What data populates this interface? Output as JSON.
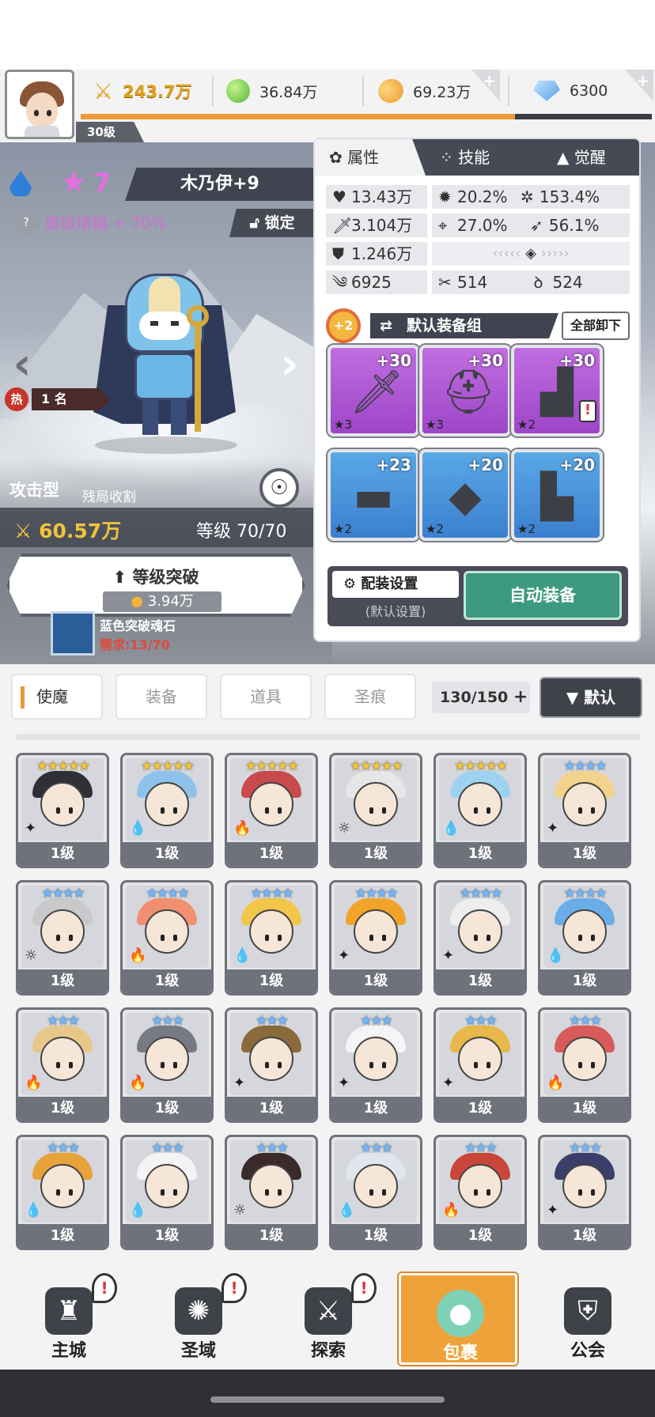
{
  "player": {
    "level": "30级",
    "xp_progress": 0.76
  },
  "currencies": {
    "power": "243.7万",
    "green_orb": "36.84万",
    "gold": "69.23万",
    "diamond": "6300"
  },
  "hero": {
    "element_icon": "water-drop-icon",
    "star_count": "7",
    "name": "木乃伊+9",
    "star_boost": "星级增幅 + 70%",
    "lock_label": "锁定",
    "rank_hot": "热",
    "rank": "1 名",
    "role": "攻击型",
    "role_desc": "残局收割",
    "power": "60.57万",
    "level": "等级 70/70",
    "breakthrough_label": "等级突破",
    "breakthrough_cost": "3.94万",
    "soul_stone_name": "蓝色突破魂石",
    "soul_stone_need": "需求:13/70"
  },
  "panel": {
    "tabs": [
      "属性",
      "技能",
      "觉醒"
    ],
    "stats": {
      "hp": "13.43万",
      "crit_rate": "20.2%",
      "crit_dmg": "153.4%",
      "atk": "3.104万",
      "accuracy": "27.0%",
      "dodge": "56.1%",
      "def": "1.246万",
      "speed": "6925",
      "stat_a": "514",
      "stat_b": "524"
    },
    "gear_bonus": "+2",
    "gear_group": "默认装备组",
    "unequip_all": "全部卸下",
    "slots": [
      {
        "level": "+30",
        "stars": "★3",
        "color": "purple",
        "icon": "sword-icon"
      },
      {
        "level": "+30",
        "stars": "★3",
        "color": "purple",
        "icon": "helmet-icon"
      },
      {
        "level": "+30",
        "stars": "★2",
        "color": "purple",
        "icon": "armor-icon",
        "alert": "!"
      },
      {
        "level": "+23",
        "stars": "★2",
        "color": "blue",
        "icon": "belt-icon"
      },
      {
        "level": "+20",
        "stars": "★2",
        "color": "blue",
        "icon": "necklace-icon"
      },
      {
        "level": "+20",
        "stars": "★2",
        "color": "blue",
        "icon": "boots-icon"
      }
    ],
    "config_label": "配装设置",
    "config_sub": "(默认设置)",
    "auto_equip": "自动装备"
  },
  "bag": {
    "tabs": [
      "使魔",
      "装备",
      "道具",
      "圣痕"
    ],
    "capacity": "130/150",
    "capacity_plus": "+",
    "sort_label": "▼ 默认"
  },
  "cards": [
    {
      "stars": "★★★★★",
      "level": "1级",
      "elem": "✦",
      "hat": "#2f2f38"
    },
    {
      "stars": "★★★★★",
      "level": "1级",
      "elem": "💧",
      "hat": "#8fc2ea"
    },
    {
      "stars": "★★★★★",
      "level": "1级",
      "elem": "🔥",
      "hat": "#c84a4a"
    },
    {
      "stars": "★★★★★",
      "level": "1级",
      "elem": "☼",
      "hat": "#e6e6e6"
    },
    {
      "stars": "★★★★★",
      "level": "1级",
      "elem": "💧",
      "hat": "#9fd2f0"
    },
    {
      "stars": "★★★★",
      "level": "1级",
      "elem": "✦",
      "hat": "#f2d38c"
    },
    {
      "stars": "★★★★",
      "level": "1级",
      "elem": "☼",
      "hat": "#c9c9cc"
    },
    {
      "stars": "★★★★",
      "level": "1级",
      "elem": "🔥",
      "hat": "#f09070"
    },
    {
      "stars": "★★★★",
      "level": "1级",
      "elem": "💧",
      "hat": "#f2c64a"
    },
    {
      "stars": "★★★★",
      "level": "1级",
      "elem": "✦",
      "hat": "#f0a42a"
    },
    {
      "stars": "★★★★",
      "level": "1级",
      "elem": "✦",
      "hat": "#eeeeee"
    },
    {
      "stars": "★★★★",
      "level": "1级",
      "elem": "💧",
      "hat": "#6aaee8"
    },
    {
      "stars": "★★★",
      "level": "1级",
      "elem": "🔥",
      "hat": "#e8c88a"
    },
    {
      "stars": "★★★",
      "level": "1级",
      "elem": "🔥",
      "hat": "#777a82"
    },
    {
      "stars": "★★★",
      "level": "1级",
      "elem": "✦",
      "hat": "#8a6a3a"
    },
    {
      "stars": "★★★",
      "level": "1级",
      "elem": "✦",
      "hat": "#f5f5f5"
    },
    {
      "stars": "★★★",
      "level": "1级",
      "elem": "✦",
      "hat": "#e8b84a"
    },
    {
      "stars": "★★★",
      "level": "1级",
      "elem": "🔥",
      "hat": "#d85a5a"
    },
    {
      "stars": "★★★",
      "level": "1级",
      "elem": "💧",
      "hat": "#e8a23a"
    },
    {
      "stars": "★★★",
      "level": "1级",
      "elem": "💧",
      "hat": "#f4f4f4"
    },
    {
      "stars": "★★★",
      "level": "1级",
      "elem": "☼",
      "hat": "#3a2a2a"
    },
    {
      "stars": "★★★",
      "level": "1级",
      "elem": "💧",
      "hat": "#e0e6ee"
    },
    {
      "stars": "★★★",
      "level": "1级",
      "elem": "🔥",
      "hat": "#c8463a"
    },
    {
      "stars": "★★★",
      "level": "1级",
      "elem": "✦",
      "hat": "#3a3f6a"
    }
  ],
  "nav": [
    {
      "label": "主城",
      "icon": "castle-icon",
      "alert": "!"
    },
    {
      "label": "圣域",
      "icon": "vortex-icon",
      "alert": "!"
    },
    {
      "label": "探索",
      "icon": "sword-in-stone-icon",
      "alert": "!"
    },
    {
      "label": "包裹",
      "icon": "bag-icon",
      "active": true
    },
    {
      "label": "公会",
      "icon": "guild-icon"
    }
  ]
}
